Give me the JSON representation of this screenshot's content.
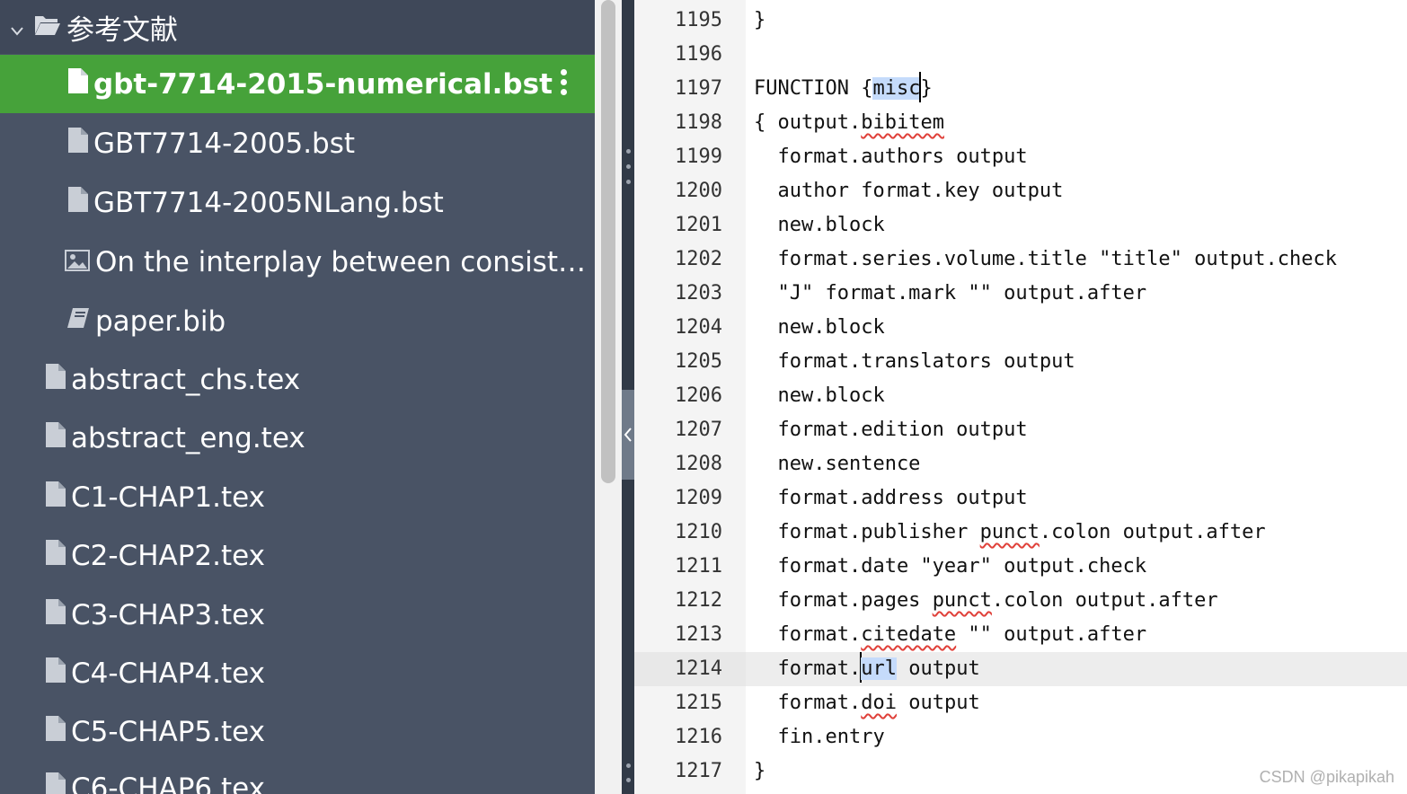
{
  "file_tree": {
    "folder": {
      "label": "参考文献",
      "icon": "folder-open-icon",
      "expanded": true
    },
    "items": [
      {
        "label": "gbt-7714-2015-numerical.bst",
        "icon": "file-icon",
        "selected": true
      },
      {
        "label": "GBT7714-2005.bst",
        "icon": "file-icon"
      },
      {
        "label": "GBT7714-2005NLang.bst",
        "icon": "file-icon"
      },
      {
        "label": "On the interplay between consistency, .",
        "icon": "image-icon"
      },
      {
        "label": "paper.bib",
        "icon": "book-icon"
      },
      {
        "label": "abstract_chs.tex",
        "icon": "file-icon"
      },
      {
        "label": "abstract_eng.tex",
        "icon": "file-icon"
      },
      {
        "label": "C1-CHAP1.tex",
        "icon": "file-icon"
      },
      {
        "label": "C2-CHAP2.tex",
        "icon": "file-icon"
      },
      {
        "label": "C3-CHAP3.tex",
        "icon": "file-icon"
      },
      {
        "label": "C4-CHAP4.tex",
        "icon": "file-icon"
      },
      {
        "label": "C5-CHAP5.tex",
        "icon": "file-icon"
      },
      {
        "label": "C6-CHAP6.tex",
        "icon": "file-icon"
      }
    ]
  },
  "colors": {
    "sidebar_bg": "#495365",
    "selected_bg": "#46a23a",
    "highlight": "#c5dbfb",
    "squiggle": "#e0413a"
  },
  "editor": {
    "active_line": "1214",
    "lines": [
      {
        "n": "1195",
        "text": "}"
      },
      {
        "n": "1196",
        "text": ""
      },
      {
        "n": "1197",
        "text": "FUNCTION {misc}"
      },
      {
        "n": "1198",
        "text": "{ output.bibitem"
      },
      {
        "n": "1199",
        "text": "  format.authors output"
      },
      {
        "n": "1200",
        "text": "  author format.key output"
      },
      {
        "n": "1201",
        "text": "  new.block"
      },
      {
        "n": "1202",
        "text": "  format.series.volume.title \"title\" output.check"
      },
      {
        "n": "1203",
        "text": "  \"J\" format.mark \"\" output.after"
      },
      {
        "n": "1204",
        "text": "  new.block"
      },
      {
        "n": "1205",
        "text": "  format.translators output"
      },
      {
        "n": "1206",
        "text": "  new.block"
      },
      {
        "n": "1207",
        "text": "  format.edition output"
      },
      {
        "n": "1208",
        "text": "  new.sentence"
      },
      {
        "n": "1209",
        "text": "  format.address output"
      },
      {
        "n": "1210",
        "text": "  format.publisher punct.colon output.after"
      },
      {
        "n": "1211",
        "text": "  format.date \"year\" output.check"
      },
      {
        "n": "1212",
        "text": "  format.pages punct.colon output.after"
      },
      {
        "n": "1213",
        "text": "  format.citedate \"\" output.after"
      },
      {
        "n": "1214",
        "text": "  format.url output"
      },
      {
        "n": "1215",
        "text": "  format.doi output"
      },
      {
        "n": "1216",
        "text": "  fin.entry"
      },
      {
        "n": "1217",
        "text": "}"
      }
    ],
    "segments": {
      "l1197_a": "FUNCTION {",
      "l1197_hl": "misc",
      "l1197_b": "}",
      "l1198_a": "{ output.",
      "l1198_sq": "bibitem",
      "l1210_a": "  format.publisher ",
      "l1210_sq": "punct",
      "l1210_b": ".colon output.after",
      "l1212_a": "  format.pages ",
      "l1212_sq": "punct",
      "l1212_b": ".colon output.after",
      "l1213_a": "  format.",
      "l1213_sq": "citedate",
      "l1213_b": " \"\" output.after",
      "l1214_a": "  format.",
      "l1214_hl": "url",
      "l1214_b": " output",
      "l1215_a": "  format.",
      "l1215_sq": "doi",
      "l1215_b": " output"
    }
  },
  "watermark": "CSDN @pikapikah"
}
